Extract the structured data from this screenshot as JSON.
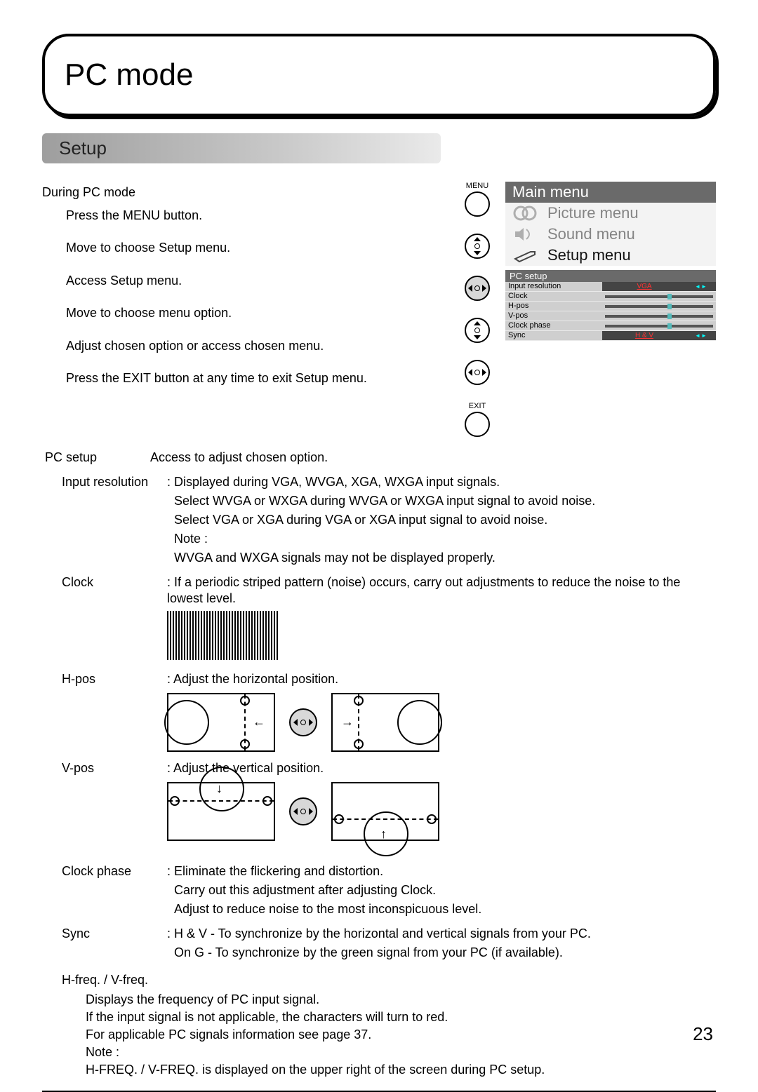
{
  "page_title": "PC mode",
  "section_title": "Setup",
  "lead": "During PC mode",
  "steps": [
    "Press the MENU button.",
    "Move to choose Setup menu.",
    "Access Setup menu.",
    "Adjust chosen option or access chosen menu.",
    "Move to choose menu option.",
    "Press the EXIT button at any time to exit Setup menu."
  ],
  "icon_labels": {
    "menu": "MENU",
    "exit": "EXIT"
  },
  "osd": {
    "main_title": "Main menu",
    "items": [
      {
        "label": "Picture menu",
        "active": false
      },
      {
        "label": "Sound menu",
        "active": false
      },
      {
        "label": "Setup menu",
        "active": true
      }
    ],
    "pc_setup_title": "PC setup",
    "rows": [
      {
        "label": "Input resolution",
        "type": "value",
        "value": "VGA"
      },
      {
        "label": "Clock",
        "type": "slider"
      },
      {
        "label": "H-pos",
        "type": "slider"
      },
      {
        "label": "V-pos",
        "type": "slider"
      },
      {
        "label": "Clock phase",
        "type": "slider"
      },
      {
        "label": "Sync",
        "type": "value",
        "value": "H & V"
      }
    ]
  },
  "defs": {
    "pc_setup_label": "PC setup",
    "pc_setup_body": "Access to adjust chosen option.",
    "input_res_label": "Input resolution",
    "input_res_body": [
      ": Displayed during VGA, WVGA, XGA, WXGA input signals.",
      "Select WVGA or WXGA during WVGA or WXGA input signal to avoid noise.",
      "Select VGA or XGA during VGA or XGA input signal to avoid noise.",
      "Note :",
      "WVGA and WXGA signals may not be displayed properly."
    ],
    "clock_label": "Clock",
    "clock_body": ": If a periodic striped pattern (noise) occurs, carry out adjustments to reduce the noise to the lowest level.",
    "hpos_label": "H-pos",
    "hpos_body": ": Adjust the horizontal position.",
    "vpos_label": "V-pos",
    "vpos_body": ": Adjust the vertical position.",
    "clockphase_label": "Clock phase",
    "clockphase_body": [
      ": Eliminate the flickering and distortion.",
      "Carry out this adjustment after adjusting Clock.",
      "Adjust to reduce noise to the most inconspicuous level."
    ],
    "sync_label": "Sync",
    "sync_body": [
      ": H & V  - To synchronize by the horizontal and vertical signals from your PC.",
      "On G   - To synchronize by the green signal from your PC (if available)."
    ],
    "hfreq_label": "H-freq. / V-freq.",
    "hfreq_body": [
      "Displays the frequency of PC input signal.",
      "If the input signal is not applicable, the characters will turn to red.",
      "For applicable PC signals information see page 37.",
      "Note :",
      "H-FREQ. / V-FREQ. is displayed on the upper right of the screen during PC setup."
    ]
  },
  "page_number": "23"
}
